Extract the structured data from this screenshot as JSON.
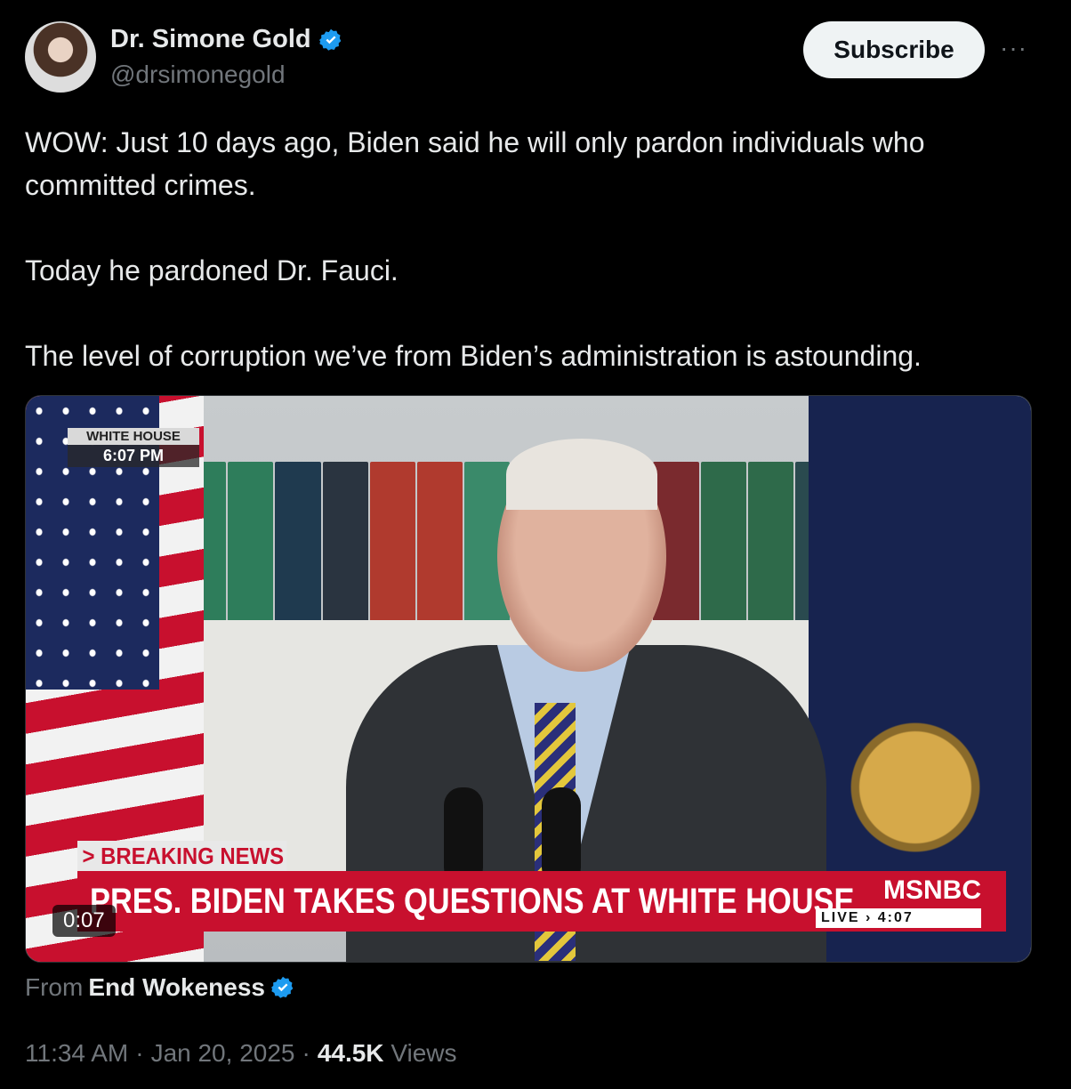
{
  "author": {
    "display_name": "Dr. Simone Gold",
    "handle": "@drsimonegold"
  },
  "actions": {
    "subscribe_label": "Subscribe",
    "more_label": "···"
  },
  "tweet": {
    "paragraphs": [
      "WOW: Just 10 days ago, Biden said he will only pardon individuals who committed crimes.",
      "Today he pardoned Dr. Fauci.",
      "The level of corruption we’ve from Biden’s administration is astounding."
    ]
  },
  "media": {
    "location_label": "WHITE HOUSE",
    "location_time": "6:07 PM",
    "breaking_label": "> BREAKING NEWS",
    "headline": "PRES. BIDEN TAKES QUESTIONS AT WHITE HOUSE",
    "network": "MSNBC",
    "live_label": "LIVE › 4:07",
    "duration": "0:07"
  },
  "attribution": {
    "from_label": "From",
    "from_name": "End Wokeness"
  },
  "meta": {
    "time": "11:34 AM",
    "separator": "·",
    "date": "Jan 20, 2025",
    "views_count": "44.5K",
    "views_label": "Views"
  },
  "colors": {
    "verified": "#1d9bf0",
    "background": "#000000",
    "muted_text": "#71767b"
  }
}
